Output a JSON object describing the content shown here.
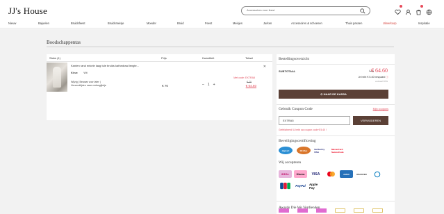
{
  "header": {
    "logo": "JJ's House",
    "search_placeholder": "Accessoires voor feest"
  },
  "nav": {
    "items": [
      "Nieuw",
      "Bajuelen",
      "Bruidsfeest",
      "Bruidsmeisje",
      "Moeder",
      "Bruid",
      "Feest",
      "Meisjes",
      "Jurken",
      "Accessoires & schoenen",
      "Thuis passen"
    ],
    "sale": "Uitverkoop",
    "last": "Inspiratie"
  },
  "page_title": "Boodschappentas",
  "cart": {
    "columns": {
      "items": "Stuks (1)",
      "price": "Prijs",
      "quantity": "Kwantiteit",
      "total": "Totaal"
    },
    "item": {
      "name": "Kanten rand enkele laag tule bruids kathedraal lengte...",
      "attr_label": "Kleur:",
      "attr_value": "Wit",
      "edit_link": "Wijzig",
      "wishlist_link": "Bewaar voor later",
      "shipping_link": "Verzendtijden naar verlanglijstje",
      "price": "€ 70",
      "quantity": "1",
      "minus": "–",
      "plus": "+",
      "discount_code": "Met code: EXTRA5",
      "old_total": "€ 70",
      "new_total": "€ 64.60"
    }
  },
  "summary": {
    "title": "Bestellingsoverzicht",
    "subtotal_label": "SUBTOTAAL",
    "subtotal_old": "€ 70",
    "subtotal_new": "€ 64.60",
    "saved_prefix": "Je hebt",
    "saved_amount": "€ 5.40",
    "saved_suffix": "bespaard",
    "incl": "exclusief BTW",
    "checkout_label": "NAAR DE KASSA"
  },
  "coupon": {
    "title": "Gebruik Coupon Code",
    "more_link": "Mijn coupons",
    "value": "EXTRA5",
    "remove_button": "VERWIJDEREN",
    "message": "Gefeliciteerd! U hebt uw coupon code € 5.40 !"
  },
  "certification": {
    "title": "Beveiligingscertificering",
    "logos": [
      "digicert",
      "McAfee",
      "Verified by VISA",
      "MasterCard SecureCode"
    ]
  },
  "payments": {
    "title": "Wij accepteren",
    "methods": [
      "iDEAL",
      "Klarna",
      "VISA",
      "MasterCard",
      "AMEX",
      "DISCOVER",
      "Diners Club",
      "JCB",
      "PayPal",
      "Apple Pay"
    ]
  },
  "awards": {
    "title": "Awards Die We Verdienden"
  },
  "colors": {
    "accent": "#e24a5a",
    "button": "#5b4036"
  }
}
